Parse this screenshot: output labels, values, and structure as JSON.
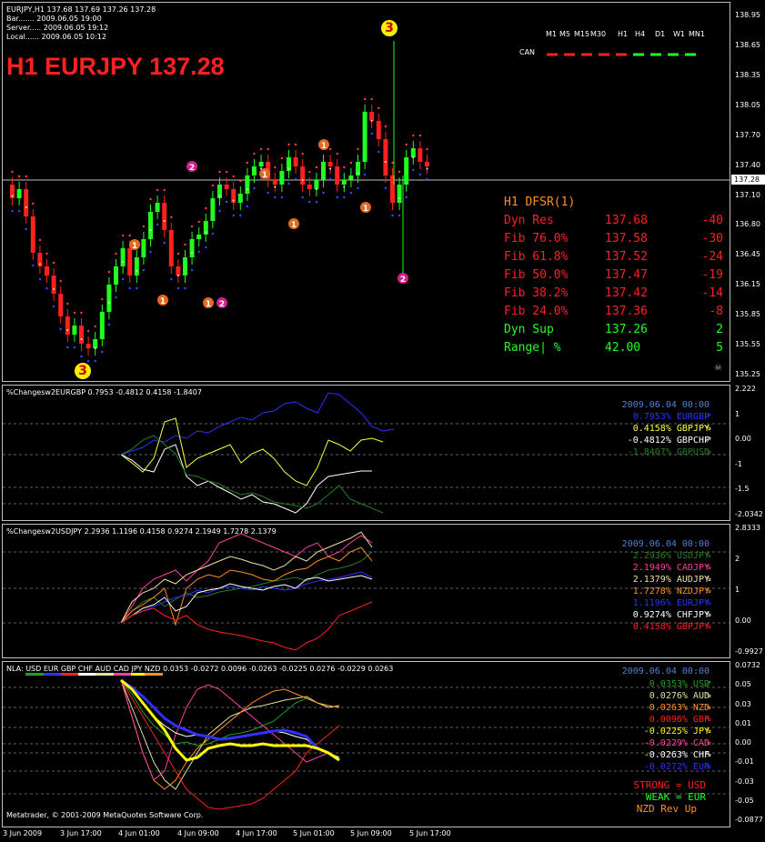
{
  "window": {
    "header_line": "EURJPY,H1  137.68 137.69 137.26 137.28",
    "bar": "Bar.......  2009.06.05 19:00",
    "server": "Server.....  2009.06.05 19:12",
    "local": "Local......  2009.06.05 10:12",
    "title": "H1 EURJPY 137.28",
    "current_price": "137.28"
  },
  "timeframes": {
    "labels": [
      "M1",
      "M5",
      "M15",
      "M30",
      "H1",
      "H4",
      "D1",
      "W1",
      "MN1"
    ],
    "can_label": "CAN",
    "colors": [
      "#ff2020",
      "#ff2020",
      "#ff2020",
      "#ff2020",
      "#ff2020",
      "#20ff20",
      "#20ff20",
      "#20ff20",
      "#20ff20"
    ]
  },
  "markers": {
    "three": "3",
    "one": "1",
    "two": "2"
  },
  "dfsr": {
    "title": "H1 DFSR(1)",
    "rows": [
      {
        "label": "Dyn Res    ",
        "price": "137.68",
        "diff": "-40",
        "color": "#ff2020"
      },
      {
        "label": "Fib 76.0%  ",
        "price": "137.58",
        "diff": "-30",
        "color": "#ff2020"
      },
      {
        "label": "Fib 61.8%  ",
        "price": "137.52",
        "diff": "-24",
        "color": "#ff2020"
      },
      {
        "label": "Fib 50.0%  ",
        "price": "137.47",
        "diff": "-19",
        "color": "#ff2020"
      },
      {
        "label": "Fib 38.2%  ",
        "price": "137.42",
        "diff": "-14",
        "color": "#ff2020"
      },
      {
        "label": "Fib 24.0%  ",
        "price": "137.36",
        "diff": "-8",
        "color": "#ff2020"
      },
      {
        "label": "Dyn Sup    ",
        "price": "137.26",
        "diff": "2",
        "color": "#20ff20"
      },
      {
        "label": "Range| %   ",
        "price": "42.00",
        "diff": "5",
        "color": "#20ff20"
      }
    ]
  },
  "main_axis": [
    "138.95",
    "138.65",
    "138.35",
    "138.05",
    "137.70",
    "137.40",
    "137.10",
    "136.80",
    "136.45",
    "136.15",
    "135.85",
    "135.55",
    "135.25"
  ],
  "ind1": {
    "title": "%Changesw2EURGBP 0.7953 -0.4812 0.4158 -1.8407",
    "date": "2009.06.04 00:00",
    "legend": [
      {
        "text": " 0.7953% EURGBP",
        "color": "#3030ff",
        "arrow": "⇗"
      },
      {
        "text": " 0.4158% GBPJPY",
        "color": "#ffff40",
        "arrow": "⇘"
      },
      {
        "text": "-0.4812% GBPCHF",
        "color": "#ffffff",
        "arrow": "⇗"
      },
      {
        "text": "-1.8407% GBPUSD",
        "color": "#208020",
        "arrow": "⇘"
      }
    ],
    "axis": [
      "2.222",
      "1",
      "0.00",
      "-1",
      "-1.5",
      "-2.0342"
    ]
  },
  "ind2": {
    "title": "%Changesw2USDJPY 2.2936 1.1196 0.4158 0.9274 2.1949 1.7278 2.1379",
    "date": "2009.06.04 00:00",
    "legend": [
      {
        "text": "2.2936% USDJPY",
        "color": "#208020",
        "arrow": "⇘"
      },
      {
        "text": "2.1949% CADJPY",
        "color": "#ff40a0",
        "arrow": "⇘"
      },
      {
        "text": "2.1379% AUDJPY",
        "color": "#f0e0a0",
        "arrow": "⇘"
      },
      {
        "text": "1.7278% NZDJPY",
        "color": "#ff9020",
        "arrow": "⇘"
      },
      {
        "text": "1.1196% EURJPY",
        "color": "#3030ff",
        "arrow": "⇘"
      },
      {
        "text": "0.9274% CHFJPY",
        "color": "#ffffff",
        "arrow": "⇘"
      },
      {
        "text": "0.4158% GBPJPY",
        "color": "#ff2020",
        "arrow": "⇘"
      }
    ],
    "axis": [
      "2.8333",
      "2",
      "1",
      "0.00",
      "-0.9927"
    ]
  },
  "ind3": {
    "title_prefix": "NLA:",
    "currencies": [
      {
        "name": "USD",
        "color": "#20a020"
      },
      {
        "name": "EUR",
        "color": "#3030ff"
      },
      {
        "name": "GBP",
        "color": "#ff2020"
      },
      {
        "name": "CHF",
        "color": "#ffffff"
      },
      {
        "name": "AUD",
        "color": "#e0e0a0"
      },
      {
        "name": "CAD",
        "color": "#ff40a0"
      },
      {
        "name": "JPY",
        "color": "#ffff00"
      },
      {
        "name": "NZD",
        "color": "#ff9020"
      }
    ],
    "title_values": "0.0353 -0.0272 0.0096 -0.0263 -0.0225 0.0276 -0.0229 0.0263",
    "date": "2009.06.04 00:00",
    "legend": [
      {
        "text": " 0.0353% USD",
        "color": "#20a020",
        "arrow": "⇗"
      },
      {
        "text": " 0.0276% AUD",
        "color": "#e0e0a0",
        "arrow": "⇘"
      },
      {
        "text": " 0.0263% NZD",
        "color": "#ff9020",
        "arrow": "⇘"
      },
      {
        "text": " 0.0096% GBP",
        "color": "#ff2020",
        "arrow": "⇘"
      },
      {
        "text": "-0.0225% JPY",
        "color": "#ffff00",
        "arrow": "⇘"
      },
      {
        "text": "-0.0229% CAD",
        "color": "#ff40a0",
        "arrow": "⇘"
      },
      {
        "text": "-0.0263% CHF",
        "color": "#ffffff",
        "arrow": "⇘"
      },
      {
        "text": "-0.0272% EUR",
        "color": "#3030ff",
        "arrow": "⇘"
      }
    ],
    "strong": "STRONG = USD",
    "weak": "WEAK = EUR",
    "nzd": "NZD Rev Up",
    "copyright": "Metatrader, © 2001-2009 MetaQuotes Software Corp.",
    "axis": [
      "0.0732",
      "0.05",
      "0.03",
      "0.01",
      "0.00",
      "-0.01",
      "-0.03",
      "-0.05",
      "-0.0877"
    ]
  },
  "x_axis": [
    "3 Jun 2009",
    "3 Jun 17:00",
    "4 Jun 01:00",
    "4 Jun 09:00",
    "4 Jun 17:00",
    "5 Jun 01:00",
    "5 Jun 09:00",
    "5 Jun 17:00"
  ]
}
